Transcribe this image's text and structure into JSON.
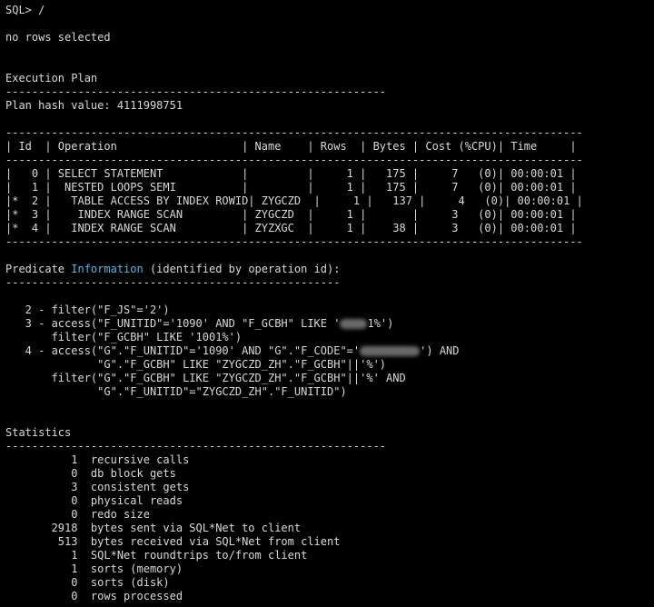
{
  "colors": {
    "background": "#000000",
    "text": "#d8d8d8",
    "highlight": "#4fb8e6"
  },
  "prompt": "SQL> /",
  "result": "no rows selected",
  "execution_plan": {
    "heading": "Execution Plan",
    "separator_short": "----------------------------------------------------------",
    "plan_hash_line": "Plan hash value: 4111998751",
    "table_rule": "----------------------------------------------------------------------------------------",
    "table_header": "| Id  | Operation                   | Name    | Rows  | Bytes | Cost (%CPU)| Time     |",
    "rows": [
      "|   0 | SELECT STATEMENT            |         |     1 |   175 |     7   (0)| 00:00:01 |",
      "|   1 |  NESTED LOOPS SEMI          |         |     1 |   175 |     7   (0)| 00:00:01 |",
      "|*  2 |   TABLE ACCESS BY INDEX ROWID| ZYGCZD  |     1 |   137 |     4   (0)| 00:00:01 |",
      "|*  3 |    INDEX RANGE SCAN         | ZYGCZD  |     1 |       |     3   (0)| 00:00:01 |",
      "|*  4 |   INDEX RANGE SCAN          | ZYZXGC  |     1 |    38 |     3   (0)| 00:00:01 |"
    ]
  },
  "predicate": {
    "heading_prefix": "Predicate ",
    "heading_highlight": "Information",
    "heading_suffix": " (identified by operation id):",
    "separator": "---------------------------------------------------",
    "line1": "   2 - filter(\"F_JS\"='2')",
    "line2_prefix": "   3 - access(\"F_UNITID\"='1090' AND \"F_GCBH\" LIKE '",
    "line2_suffix": "1%')",
    "line3": "       filter(\"F_GCBH\" LIKE '1001%')",
    "line4_prefix": "   4 - access(\"G\".\"F_UNITID\"='1090' AND \"G\".\"F_CODE\"='",
    "line4_suffix": "') AND",
    "line5": "              \"G\".\"F_GCBH\" LIKE \"ZYGCZD_ZH\".\"F_GCBH\"||'%')",
    "line6": "       filter(\"G\".\"F_GCBH\" LIKE \"ZYGCZD_ZH\".\"F_GCBH\"||'%' AND",
    "line7": "              \"G\".\"F_UNITID\"=\"ZYGCZD_ZH\".\"F_UNITID\")"
  },
  "statistics": {
    "heading": "Statistics",
    "separator": "----------------------------------------------------------",
    "rows": [
      "          1  recursive calls",
      "          0  db block gets",
      "          3  consistent gets",
      "          0  physical reads",
      "          0  redo size",
      "       2918  bytes sent via SQL*Net to client",
      "        513  bytes received via SQL*Net from client",
      "          1  SQL*Net roundtrips to/from client",
      "          1  sorts (memory)",
      "          0  sorts (disk)",
      "          0  rows processed"
    ]
  }
}
